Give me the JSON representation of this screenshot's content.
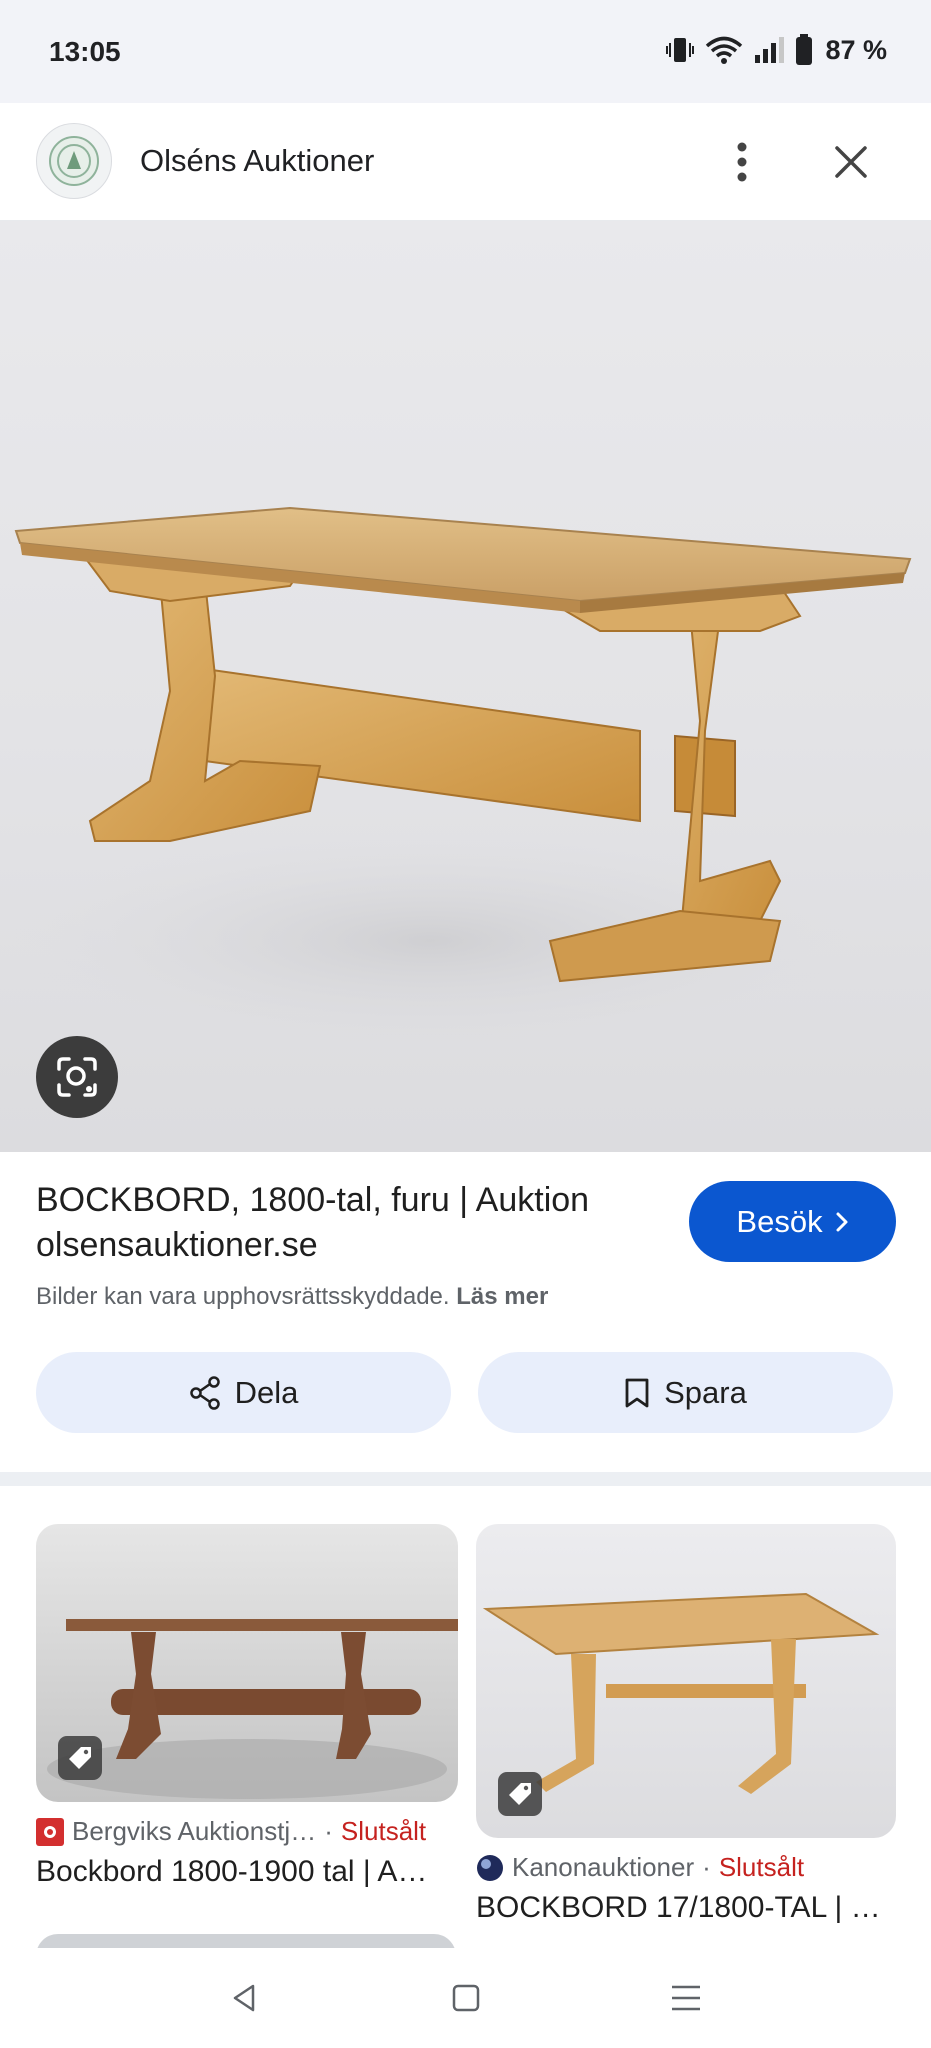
{
  "status_bar": {
    "time": "13:05",
    "battery": "87 %"
  },
  "header": {
    "title": "Olséns Auktioner"
  },
  "result": {
    "title": "BOCKBORD, 1800-tal, furu | Auktion olsensauktioner.se",
    "visit_label": "Besök",
    "copyright_text": "Bilder kan vara upphovsrättsskyddade.",
    "read_more": "Läs mer",
    "share_label": "Dela",
    "save_label": "Spara"
  },
  "related": [
    {
      "source": "Bergviks Auktionstj…",
      "status": "Slutsålt",
      "title": "Bockbord 1800-1900 tal | A…"
    },
    {
      "source": "Kanonauktioner",
      "status": "Slutsålt",
      "title": "BOCKBORD 17/1800-TAL | …"
    }
  ],
  "icons": {
    "signal": "vibrate-wifi-signal-battery",
    "menu": "more-vert-icon",
    "close": "close-icon",
    "lens": "google-lens-icon",
    "share": "share-icon",
    "save": "bookmark-icon",
    "tag": "price-tag-icon"
  },
  "colors": {
    "accent": "#0b57d0",
    "sold": "#c5221f",
    "pill_bg": "#e8eefb"
  }
}
